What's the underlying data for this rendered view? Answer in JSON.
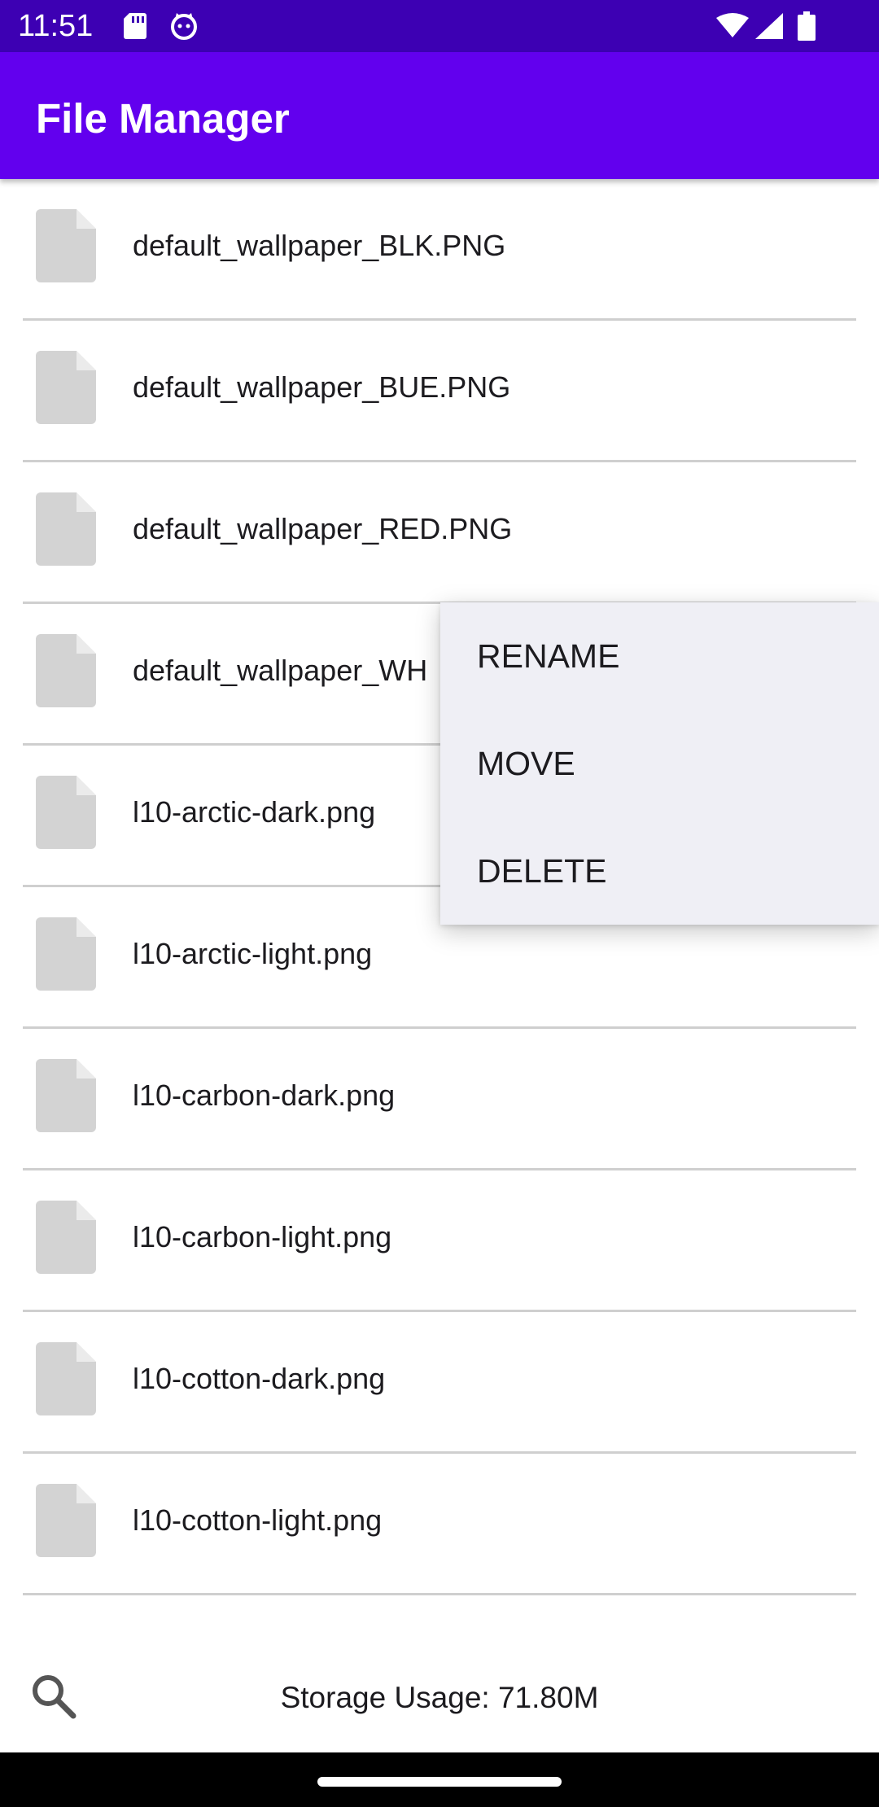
{
  "status_bar": {
    "time": "11:51",
    "icons": [
      "sd-card-icon",
      "cat-face-icon",
      "wifi-icon",
      "cellular-signal-icon",
      "battery-icon"
    ],
    "background_color": "#3d00b3"
  },
  "app_bar": {
    "title": "File Manager",
    "background_color": "#6200ee"
  },
  "files": [
    {
      "name": "default_wallpaper_BLK.PNG",
      "icon": "file-icon"
    },
    {
      "name": "default_wallpaper_BUE.PNG",
      "icon": "file-icon"
    },
    {
      "name": "default_wallpaper_RED.PNG",
      "icon": "file-icon"
    },
    {
      "name": "default_wallpaper_WH",
      "icon": "file-icon"
    },
    {
      "name": "l10-arctic-dark.png",
      "icon": "file-icon"
    },
    {
      "name": "l10-arctic-light.png",
      "icon": "file-icon"
    },
    {
      "name": "l10-carbon-dark.png",
      "icon": "file-icon"
    },
    {
      "name": "l10-carbon-light.png",
      "icon": "file-icon"
    },
    {
      "name": "l10-cotton-dark.png",
      "icon": "file-icon"
    },
    {
      "name": "l10-cotton-light.png",
      "icon": "file-icon"
    }
  ],
  "context_menu": {
    "items": [
      {
        "label": "RENAME"
      },
      {
        "label": "MOVE"
      },
      {
        "label": "DELETE"
      }
    ]
  },
  "footer": {
    "search_icon": "search-icon",
    "storage_text": "Storage Usage: 71.80M"
  }
}
